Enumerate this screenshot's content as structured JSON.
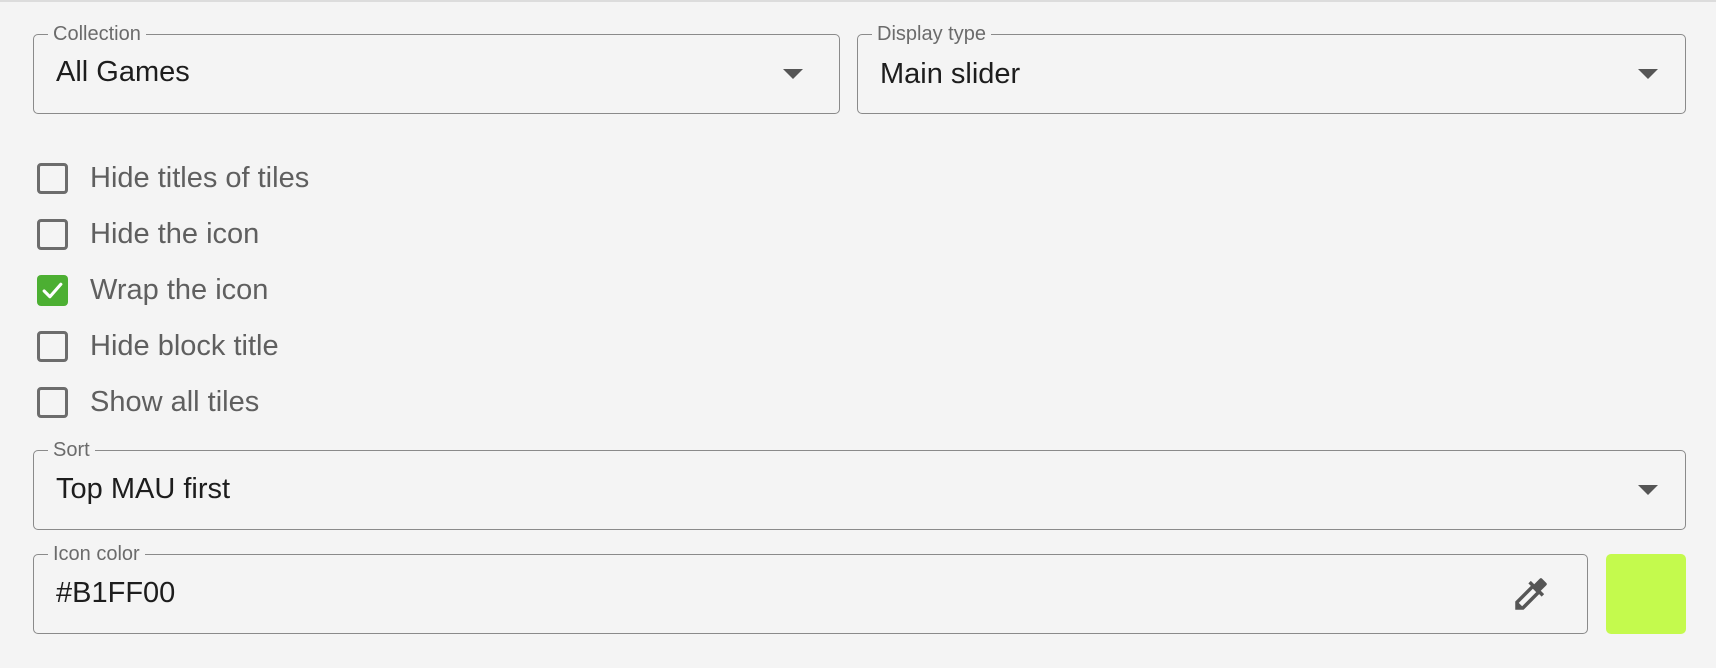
{
  "collection": {
    "label": "Collection",
    "value": "All Games"
  },
  "display_type": {
    "label": "Display type",
    "value": "Main slider"
  },
  "options": [
    {
      "label": "Hide titles of tiles",
      "checked": false
    },
    {
      "label": "Hide the icon",
      "checked": false
    },
    {
      "label": "Wrap the icon",
      "checked": true
    },
    {
      "label": "Hide block title",
      "checked": false
    },
    {
      "label": "Show all tiles",
      "checked": false
    }
  ],
  "sort": {
    "label": "Sort",
    "value": "Top MAU first"
  },
  "icon_color": {
    "label": "Icon color",
    "value": "#B1FF00",
    "swatch_color": "#c4fa4d",
    "picker_icon": "eyedropper-icon"
  },
  "colors": {
    "checkbox_checked": "#4caf32",
    "background": "#f4f4f4"
  }
}
